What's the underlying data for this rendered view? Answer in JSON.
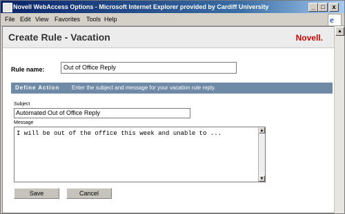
{
  "window": {
    "title": "Novell WebAccess Options - Microsoft Internet Explorer provided by Cardiff University",
    "minimize": "_",
    "maximize": "□",
    "close": "x"
  },
  "menu": [
    "File",
    "Edit",
    "View",
    "Favorites",
    "Tools",
    "Help"
  ],
  "page": {
    "title": "Create Rule - Vacation",
    "brand": "Novell."
  },
  "form": {
    "rule_name_label": "Rule name:",
    "rule_name_value": "Out of Office Reply",
    "section_title": "Define Action",
    "section_desc": "Enter the subject and message for your vacation rule reply.",
    "subject_label": "Subject",
    "subject_value": "Automated Out of Office Reply",
    "message_label": "Message",
    "message_value": "I will be out of the office this week and unable to ..."
  },
  "buttons": {
    "save": "Save",
    "cancel": "Cancel"
  }
}
